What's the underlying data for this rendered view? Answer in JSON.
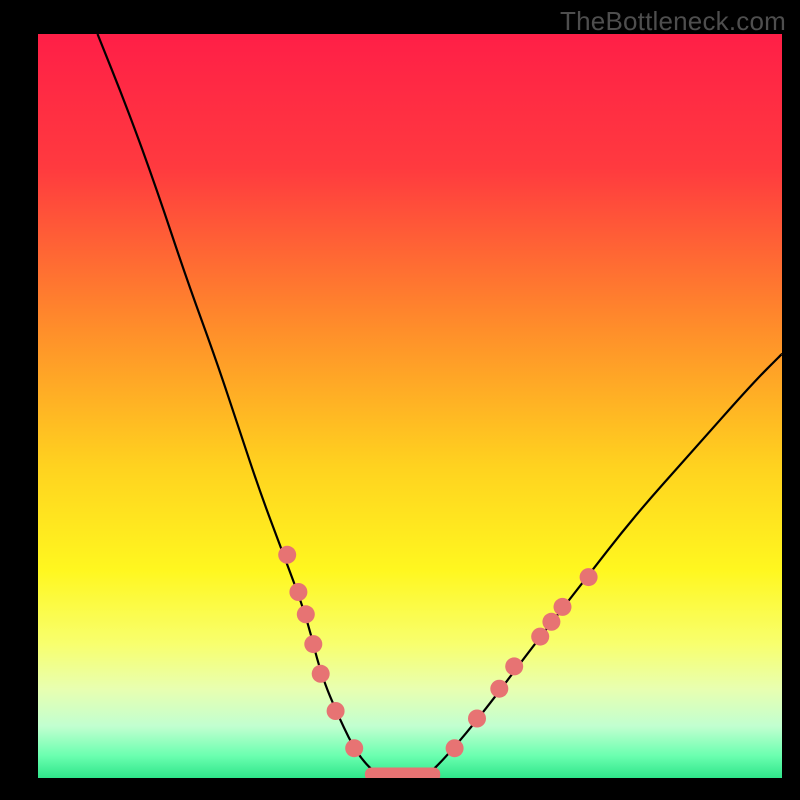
{
  "watermark": "TheBottleneck.com",
  "colors": {
    "page_background": "#000000",
    "curve": "#000000",
    "markers": "#e77373",
    "gradient_stops": [
      {
        "pos": 0.0,
        "color": "#ff1f47"
      },
      {
        "pos": 0.18,
        "color": "#ff3a3f"
      },
      {
        "pos": 0.4,
        "color": "#ff8f2a"
      },
      {
        "pos": 0.58,
        "color": "#ffd21f"
      },
      {
        "pos": 0.72,
        "color": "#fff71f"
      },
      {
        "pos": 0.82,
        "color": "#f8ff6e"
      },
      {
        "pos": 0.88,
        "color": "#e8ffb0"
      },
      {
        "pos": 0.93,
        "color": "#c2ffd0"
      },
      {
        "pos": 0.97,
        "color": "#6bffb0"
      },
      {
        "pos": 1.0,
        "color": "#2fe58a"
      }
    ]
  },
  "chart_data": {
    "type": "line",
    "title": "",
    "xlabel": "",
    "ylabel": "",
    "xlim": [
      0,
      100
    ],
    "ylim": [
      0,
      100
    ],
    "series": [
      {
        "name": "bottleneck-curve",
        "x": [
          8,
          12,
          16,
          20,
          24,
          27,
          30,
          33,
          36,
          38,
          40.5,
          43,
          46,
          49,
          52,
          55,
          60,
          66,
          73,
          80,
          88,
          96,
          100
        ],
        "y": [
          100,
          90,
          79,
          67,
          56,
          47,
          38,
          30,
          22,
          14,
          8,
          3,
          0,
          0,
          0,
          3,
          9,
          17,
          26,
          35,
          44,
          53,
          57
        ]
      }
    ],
    "markers": {
      "name": "highlighted-points",
      "points": [
        {
          "x": 33.5,
          "y": 30
        },
        {
          "x": 35.0,
          "y": 25
        },
        {
          "x": 36.0,
          "y": 22
        },
        {
          "x": 37.0,
          "y": 18
        },
        {
          "x": 38.0,
          "y": 14
        },
        {
          "x": 40.0,
          "y": 9
        },
        {
          "x": 42.5,
          "y": 4
        },
        {
          "x": 56.0,
          "y": 4
        },
        {
          "x": 59.0,
          "y": 8
        },
        {
          "x": 62.0,
          "y": 12
        },
        {
          "x": 64.0,
          "y": 15
        },
        {
          "x": 67.5,
          "y": 19
        },
        {
          "x": 69.0,
          "y": 21
        },
        {
          "x": 70.5,
          "y": 23
        },
        {
          "x": 74.0,
          "y": 27
        }
      ]
    },
    "flat_segment": {
      "x_start": 44,
      "x_end": 54,
      "y": 0
    }
  }
}
